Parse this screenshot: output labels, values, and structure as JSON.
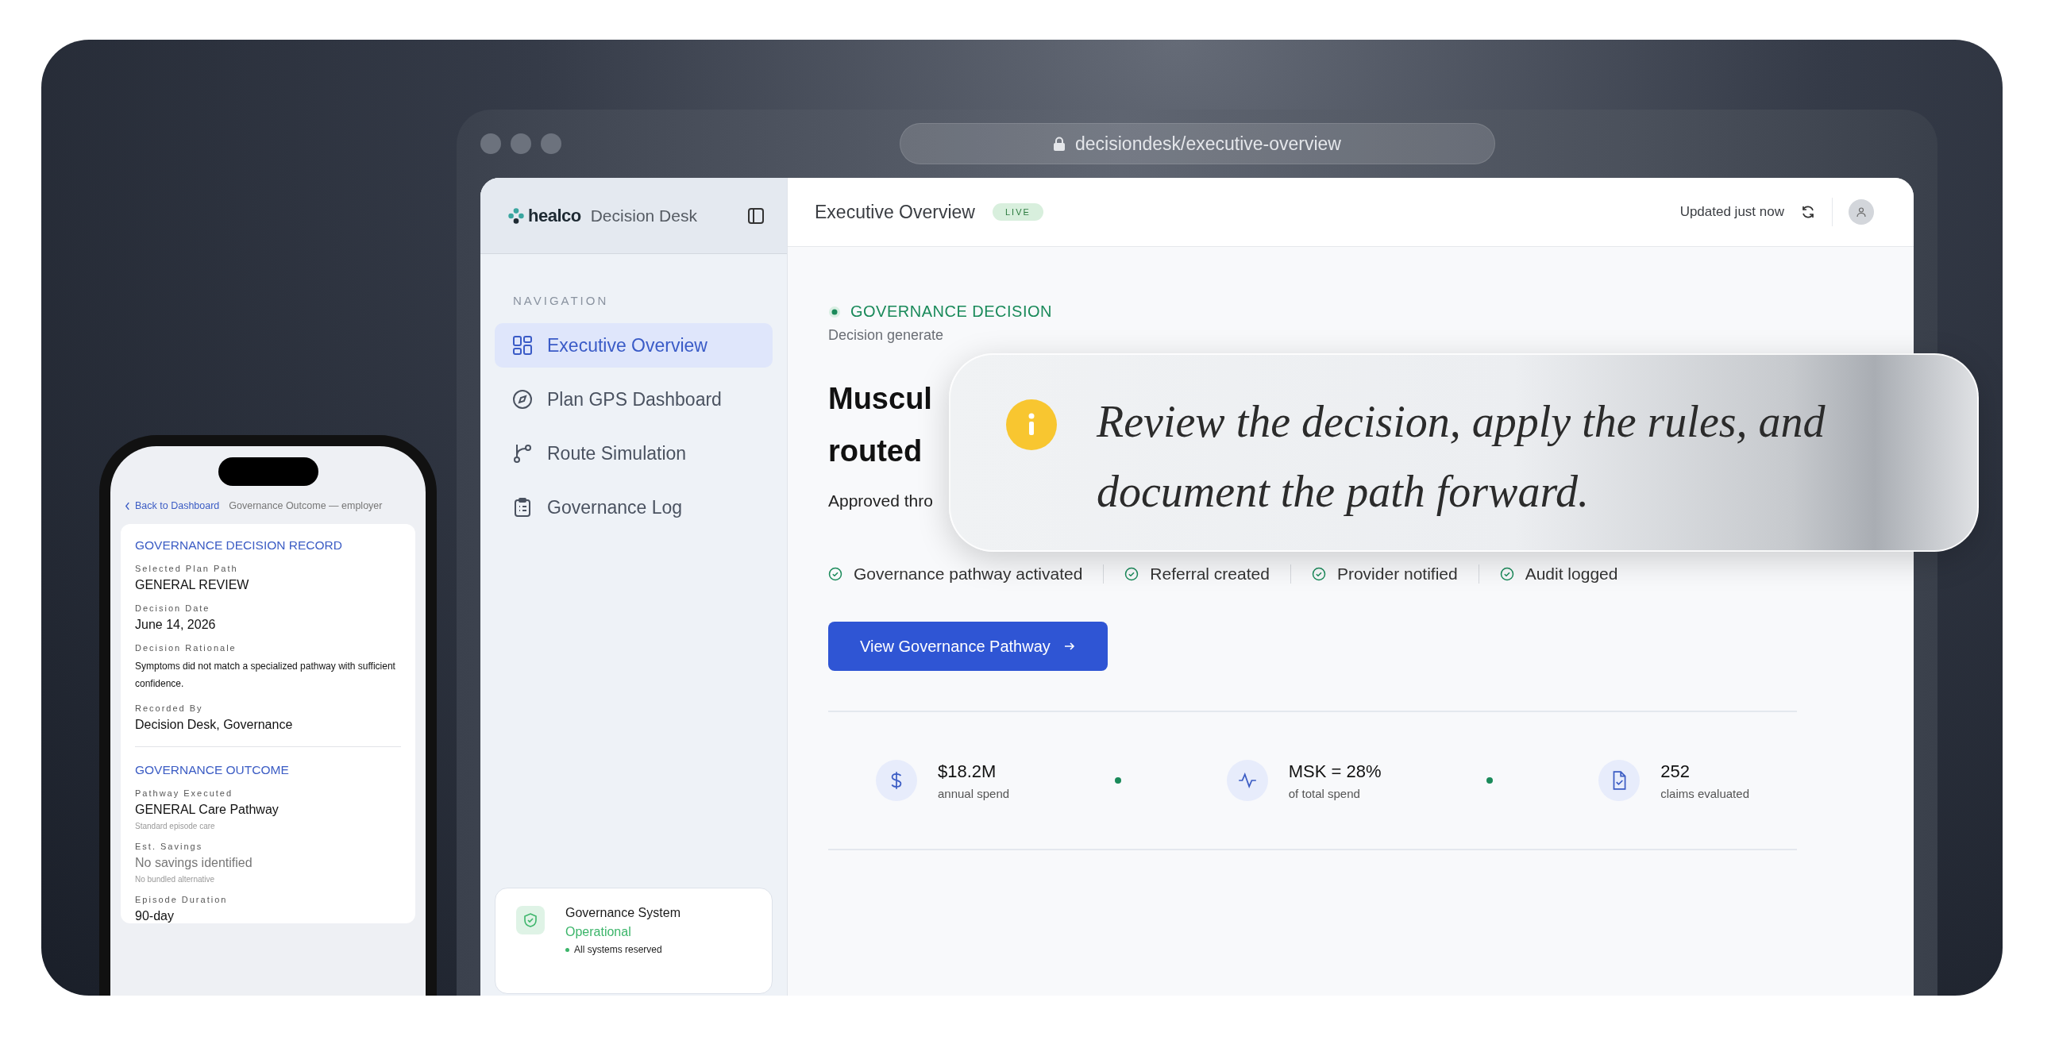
{
  "browser": {
    "url": "decisiondesk/executive-overview"
  },
  "sidebar": {
    "brand": "healco",
    "product": "Decision Desk",
    "section_label": "NAVIGATION",
    "items": [
      {
        "label": "Executive Overview",
        "selected": true
      },
      {
        "label": "Plan GPS Dashboard",
        "selected": false
      },
      {
        "label": "Route Simulation",
        "selected": false
      },
      {
        "label": "Governance Log",
        "selected": false
      }
    ],
    "status_card": {
      "title": "Governance System",
      "status": "Operational",
      "note": "All systems reserved"
    }
  },
  "header": {
    "title": "Executive Overview",
    "badge": "LIVE",
    "updated": "Updated just now"
  },
  "decision": {
    "eyebrow": "GOVERNANCE DECISION",
    "meta": "Decision generate",
    "title_lines": [
      "Muscul",
      "routed"
    ],
    "summary": "Approved thro",
    "checks": [
      "Governance pathway activated",
      "Referral created",
      "Provider notified",
      "Audit logged"
    ],
    "button": "View Governance Pathway",
    "stats": [
      {
        "value": "$18.2M",
        "label": "annual spend"
      },
      {
        "value": "MSK = 28%",
        "label": "of total spend"
      },
      {
        "value": "252",
        "label": "claims evaluated"
      }
    ]
  },
  "callout": {
    "text": "Review the decision, apply the rules, and document the path forward."
  },
  "phone": {
    "back": "Back to Dashboard",
    "crumb": "Governance Outcome — employer",
    "sections": [
      {
        "title": "GOVERNANCE DECISION RECORD",
        "fields": [
          {
            "label": "Selected Plan Path",
            "value": "GENERAL REVIEW",
            "kind": "value"
          },
          {
            "label": "Decision Date",
            "value": "June 14, 2026",
            "kind": "value"
          },
          {
            "label": "Decision Rationale",
            "value": "Symptoms did not match a specialized pathway with sufficient confidence.",
            "kind": "paragraph"
          },
          {
            "label": "Recorded By",
            "value": "Decision Desk, Governance",
            "kind": "value"
          }
        ]
      },
      {
        "title": "GOVERNANCE OUTCOME",
        "fields": [
          {
            "label": "Pathway Executed",
            "value": "GENERAL Care Pathway",
            "kind": "value",
            "note": "Standard episode care"
          },
          {
            "label": "Est. Savings",
            "value": "No savings identified",
            "kind": "muted",
            "note": "No bundled alternative"
          },
          {
            "label": "Episode Duration",
            "value": "90-day",
            "kind": "value"
          }
        ]
      }
    ]
  }
}
